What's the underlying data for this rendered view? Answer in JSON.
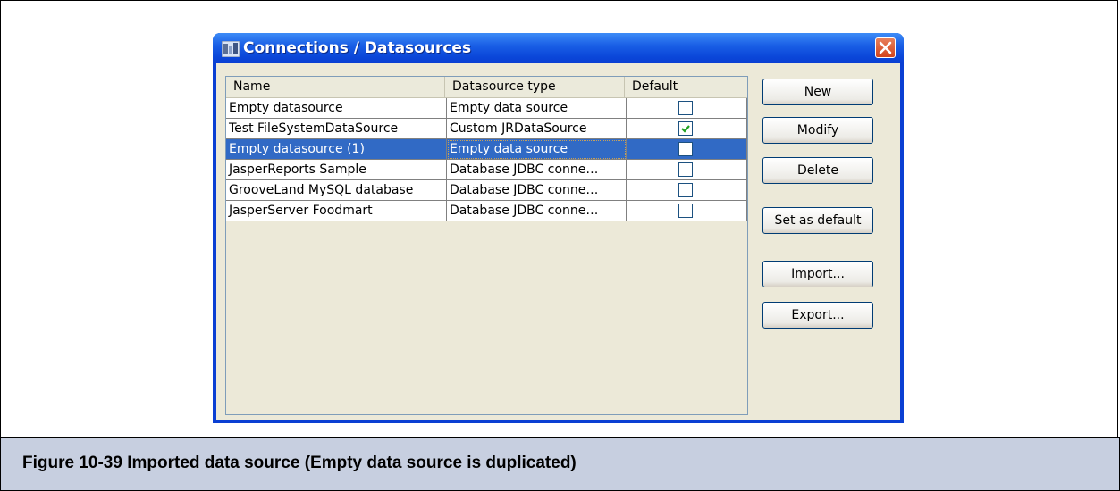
{
  "window": {
    "title": "Connections / Datasources",
    "close_label": "×"
  },
  "table": {
    "columns": [
      "Name",
      "Datasource type",
      "Default"
    ],
    "rows": [
      {
        "name": "Empty datasource",
        "type": "Empty data source",
        "default": false,
        "selected": false
      },
      {
        "name": "Test FileSystemDataSource",
        "type": "Custom JRDataSource",
        "default": true,
        "selected": false
      },
      {
        "name": "Empty datasource (1)",
        "type": "Empty data source",
        "default": false,
        "selected": true
      },
      {
        "name": "JasperReports Sample",
        "type": "Database JDBC conne…",
        "default": false,
        "selected": false
      },
      {
        "name": "GrooveLand MySQL database",
        "type": "Database JDBC conne…",
        "default": false,
        "selected": false
      },
      {
        "name": "JasperServer Foodmart",
        "type": "Database JDBC conne…",
        "default": false,
        "selected": false
      }
    ]
  },
  "buttons": {
    "new": "New",
    "modify": "Modify",
    "delete": "Delete",
    "set_default": "Set as default",
    "import": "Import...",
    "export": "Export..."
  },
  "caption": "Figure 10-39  Imported data source (Empty data source is duplicated)",
  "colors": {
    "titlebar": "#0a46d8",
    "selection": "#316ac5",
    "dialog_bg": "#ece9d8",
    "caption_bg": "#c7cfe0",
    "checkmark": "#21a121"
  }
}
